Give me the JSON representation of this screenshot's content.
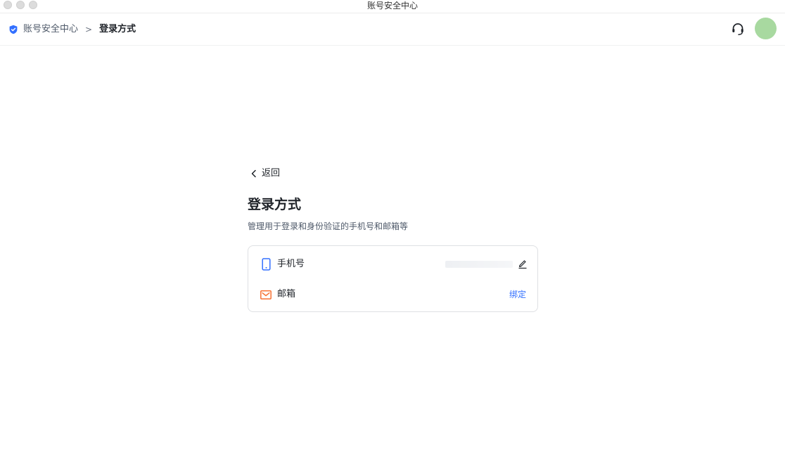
{
  "window": {
    "title": "账号安全中心"
  },
  "breadcrumb": {
    "root": "账号安全中心",
    "separator": ">",
    "current": "登录方式"
  },
  "header": {
    "support_icon": "headset-icon",
    "avatar_color": "#a8d9a0"
  },
  "main": {
    "back_label": "返回",
    "title": "登录方式",
    "description": "管理用于登录和身份验证的手机号和邮箱等",
    "methods": [
      {
        "label": "手机号",
        "icon": "phone-icon",
        "icon_color": "#3370ff",
        "action": "edit-icon"
      },
      {
        "label": "邮箱",
        "icon": "mail-icon",
        "icon_color": "#f77234",
        "action_label": "绑定"
      }
    ]
  },
  "colors": {
    "accent": "#3370ff",
    "mail": "#f77234",
    "text": "#1f2329",
    "muted": "#4e5969"
  }
}
